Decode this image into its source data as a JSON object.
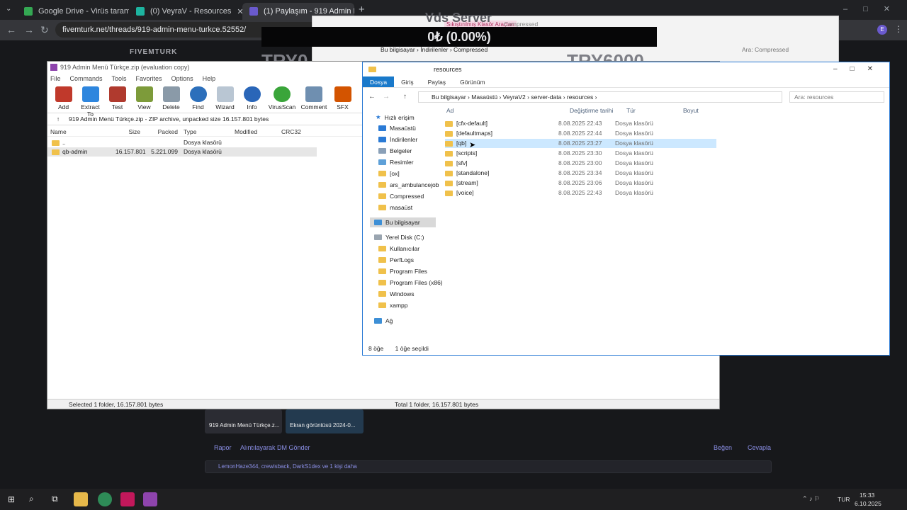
{
  "browser": {
    "tabs": [
      {
        "title": "Google Drive - Virüs taraması u",
        "icon_color": "#34a853"
      },
      {
        "title": "(0) VeyraV - Resources",
        "icon_color": "#1db4a0"
      },
      {
        "title": "(1) Paylaşım - 919 Admin Menü",
        "icon_color": "#6a5acd",
        "active": true
      }
    ],
    "url": "fivemturk.net/threads/919-admin-menu-turkce.52552/"
  },
  "overlay": {
    "balance": "0₺ (0.00%)",
    "try_left": "TRY0",
    "try_right": "TRY6000",
    "vds": "Vds Server"
  },
  "forum": {
    "logo": "FIVEMTURK",
    "attachments": [
      "919 Admin Menü Türkçe.z...",
      "Ekran görüntüsü 2024-0..."
    ],
    "report": "Rapor",
    "quote": "Alıntılayarak DM Gönder",
    "like": "Beğen",
    "reply": "Cevapla",
    "likes": "LemonHaze344, crewisback, DarkS1dex ve 1 kişi daha"
  },
  "compressed_window": {
    "tools_label": "Sıkıştırılmış Klasör Araçları",
    "title": "Compressed",
    "path": [
      "Bu bilgisayar",
      "İndirilenler",
      "Compressed"
    ],
    "search": "Ara: Compressed"
  },
  "winrar": {
    "title": "919 Admin Menü Türkçe.zip (evaluation copy)",
    "menu": [
      "File",
      "Commands",
      "Tools",
      "Favorites",
      "Options",
      "Help"
    ],
    "tools": [
      {
        "label": "Add",
        "icon": "add-icon",
        "color": "#c0392b"
      },
      {
        "label": "Extract To",
        "icon": "extract-icon",
        "color": "#2e86de"
      },
      {
        "label": "Test",
        "icon": "test-icon",
        "color": "#b03a2e"
      },
      {
        "label": "View",
        "icon": "view-icon",
        "color": "#7d9b3a"
      },
      {
        "label": "Delete",
        "icon": "delete-icon",
        "color": "#8a9aa8"
      },
      {
        "label": "Find",
        "icon": "find-icon",
        "color": "#2c6fbb"
      },
      {
        "label": "Wizard",
        "icon": "wizard-icon",
        "color": "#b9c6d3"
      },
      {
        "label": "Info",
        "icon": "info-icon",
        "color": "#2a66b8"
      },
      {
        "label": "VirusScan",
        "icon": "virusscan-icon",
        "color": "#3aa53a"
      },
      {
        "label": "Comment",
        "icon": "comment-icon",
        "color": "#6f8fb0"
      },
      {
        "label": "SFX",
        "icon": "sfx-icon",
        "color": "#d35400"
      }
    ],
    "path": "919 Admin Menü Türkçe.zip - ZIP archive, unpacked size 16.157.801 bytes",
    "columns": [
      "Name",
      "Size",
      "Packed",
      "Type",
      "Modified",
      "CRC32"
    ],
    "rows": [
      {
        "name": "..",
        "size": "",
        "packed": "",
        "type": "Dosya klasörü"
      },
      {
        "name": "qb-admin",
        "size": "16.157.801",
        "packed": "5.221.099",
        "type": "Dosya klasörü"
      }
    ],
    "status_left": "Selected 1 folder, 16.157.801 bytes",
    "status_right": "Total 1 folder, 16.157.801 bytes"
  },
  "explorer": {
    "title": "resources",
    "ribbon": [
      "Dosya",
      "Giriş",
      "Paylaş",
      "Görünüm"
    ],
    "breadcrumb": [
      "Bu bilgisayar",
      "Masaüstü",
      "VeyraV2",
      "server-data",
      "resources"
    ],
    "search": "Ara: resources",
    "nav": [
      "Hızlı erişim",
      "Masaüstü",
      "İndirilenler",
      "Belgeler",
      "Resimler",
      "[ox]",
      "ars_ambulancejob",
      "Compressed",
      "masaüst",
      "Bu bilgisayar",
      "Yerel Disk (C:)",
      "Kullanıcılar",
      "PerfLogs",
      "Program Files",
      "Program Files (x86)",
      "Windows",
      "xampp",
      "Ağ"
    ],
    "columns": [
      "Ad",
      "Değiştirme tarihi",
      "Tür",
      "Boyut"
    ],
    "files": [
      {
        "name": "[cfx-default]",
        "date": "8.08.2025 22:43",
        "type": "Dosya klasörü"
      },
      {
        "name": "[defaultmaps]",
        "date": "8.08.2025 22:44",
        "type": "Dosya klasörü"
      },
      {
        "name": "[qb]",
        "date": "8.08.2025 23:27",
        "type": "Dosya klasörü"
      },
      {
        "name": "[scripts]",
        "date": "8.08.2025 23:30",
        "type": "Dosya klasörü"
      },
      {
        "name": "[sfv]",
        "date": "8.08.2025 23:00",
        "type": "Dosya klasörü"
      },
      {
        "name": "[standalone]",
        "date": "8.08.2025 23:34",
        "type": "Dosya klasörü"
      },
      {
        "name": "[stream]",
        "date": "8.08.2025 23:06",
        "type": "Dosya klasörü"
      },
      {
        "name": "[voice]",
        "date": "8.08.2025 22:43",
        "type": "Dosya klasörü"
      }
    ],
    "status_count": "8 öğe",
    "status_sel": "1 öğe seçildi"
  },
  "taskbar": {
    "lang": "TUR",
    "time": "15:33",
    "date": "6.10.2025"
  }
}
